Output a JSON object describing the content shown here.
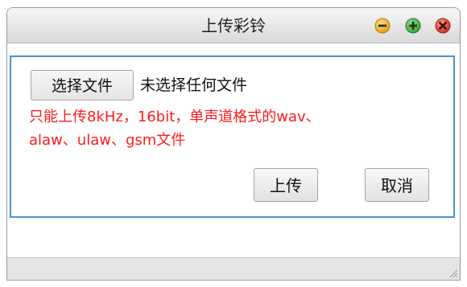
{
  "window": {
    "title": "上传彩铃"
  },
  "controls": {
    "minimize_icon": "minimize-icon",
    "maximize_icon": "maximize-icon",
    "close_icon": "close-icon"
  },
  "form": {
    "choose_file_label": "选择文件",
    "file_status": "未选择任何文件",
    "hint_line1": "只能上传8kHz，16bit，单声道格式的wav、",
    "hint_line2": "alaw、ulaw、gsm文件",
    "upload_label": "上传",
    "cancel_label": "取消"
  },
  "colors": {
    "hint": "#ff1a1a",
    "panel_border": "#4a94c6",
    "minimize": "#f2b116",
    "maximize": "#47b34a",
    "close": "#e8412f"
  }
}
